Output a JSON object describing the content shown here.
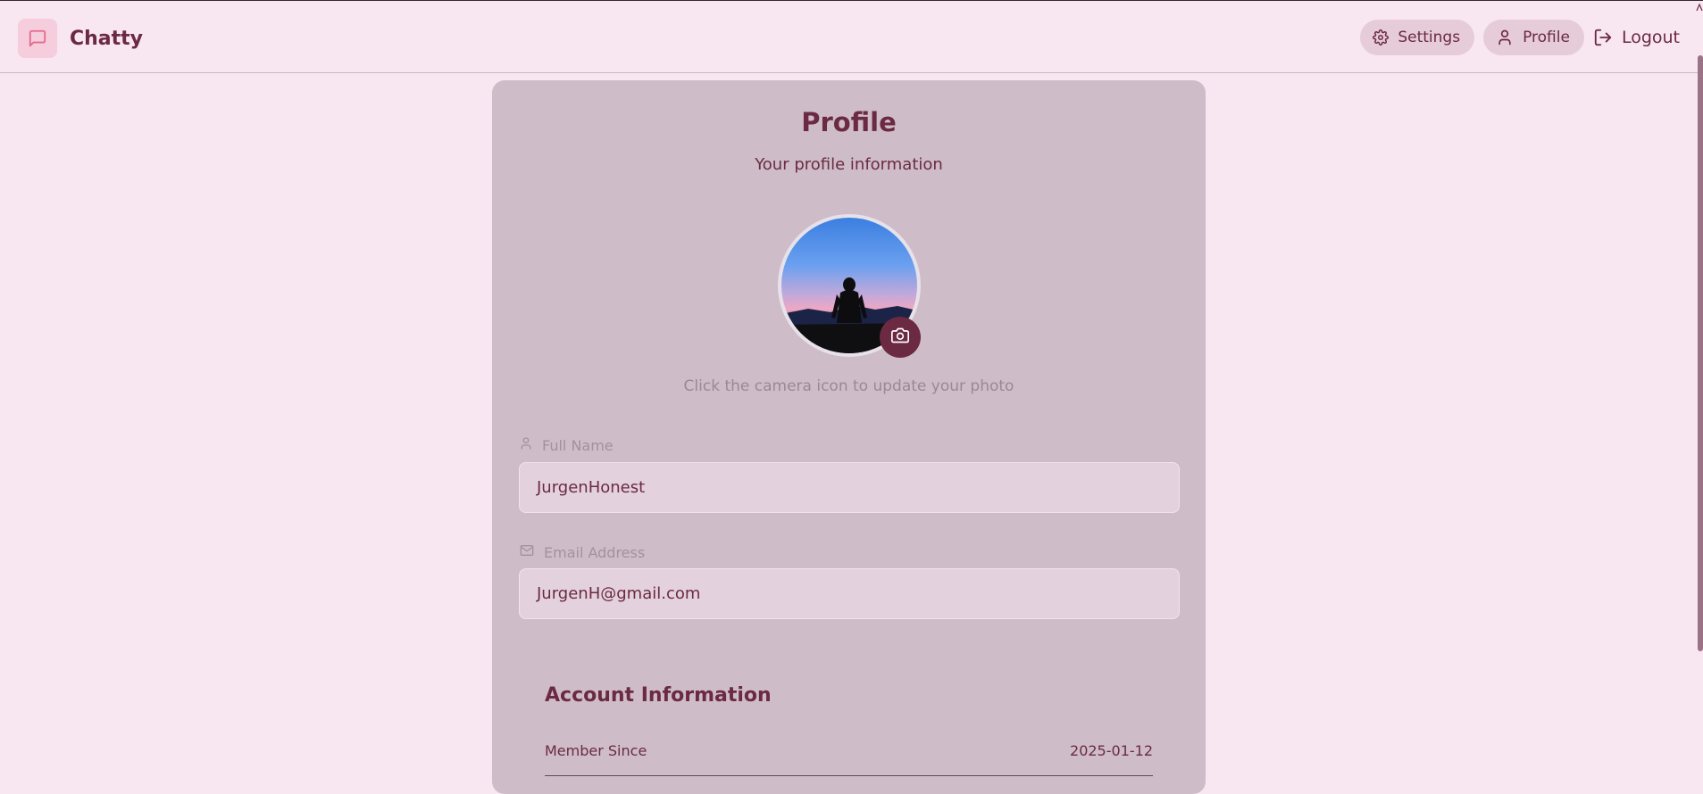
{
  "app": {
    "name": "Chatty",
    "logo_icon": "message-square-icon"
  },
  "nav": {
    "settings_label": "Settings",
    "profile_label": "Profile",
    "logout_label": "Logout"
  },
  "profile": {
    "title": "Profile",
    "subtitle": "Your profile information",
    "photo_hint": "Click the camera icon to update your photo",
    "full_name": {
      "label": "Full Name",
      "value": "JurgenHonest"
    },
    "email": {
      "label": "Email Address",
      "value": "JurgenH@gmail.com"
    }
  },
  "account": {
    "title": "Account Information",
    "rows": [
      {
        "label": "Member Since",
        "value": "2025-01-12"
      }
    ]
  },
  "colors": {
    "background": "#f8e6f1",
    "card": "#cebdc8",
    "accent": "#6b2a41",
    "input": "#e3d2dd"
  }
}
